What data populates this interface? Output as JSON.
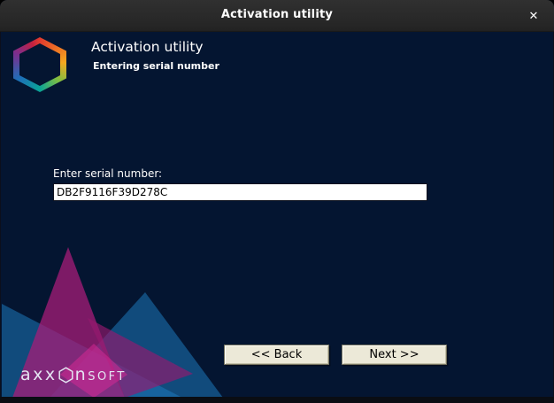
{
  "window": {
    "title": "Activation utility",
    "close_glyph": "✕"
  },
  "header": {
    "title": "Activation utility",
    "subtitle": "Entering serial number"
  },
  "form": {
    "label": "Enter serial number:",
    "serial_value": "DB2F9116F39D278C"
  },
  "buttons": {
    "back": "<< Back",
    "next": "Next >>"
  },
  "branding": {
    "wordmark_prefix": "axx",
    "wordmark_mid": "n",
    "wordmark_suffix": "soft"
  },
  "colors": {
    "body_background": "#041531",
    "titlebar": "#2a2a2a",
    "button_face": "#ece9d8",
    "accent_magenta": "#a51c78",
    "accent_teal": "#1e78b9"
  }
}
